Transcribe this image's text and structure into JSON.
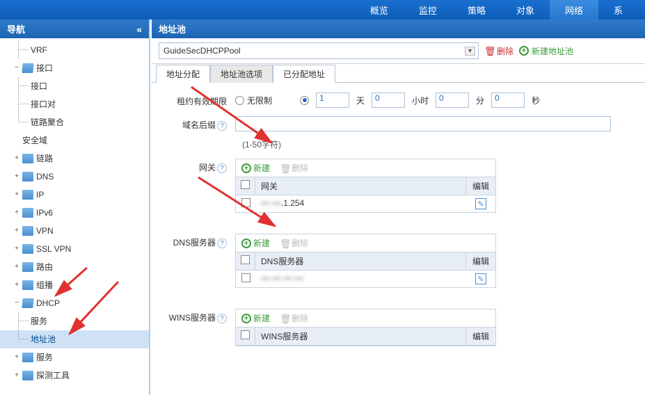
{
  "topnav": {
    "items": [
      "概览",
      "监控",
      "策略",
      "对象",
      "网络",
      "系"
    ],
    "active_index": 4
  },
  "sidebar": {
    "title": "导航",
    "collapse_glyph": "«",
    "tree": [
      {
        "label": "VRF",
        "level": 2,
        "icon": null
      },
      {
        "label": "接口",
        "level": 1,
        "icon": "open",
        "toggle": "−"
      },
      {
        "label": "接口",
        "level": 2,
        "icon": null
      },
      {
        "label": "接口对",
        "level": 2,
        "icon": null
      },
      {
        "label": "链路聚合",
        "level": 2,
        "icon": null,
        "last": true
      },
      {
        "label": "安全域",
        "level": 1,
        "icon": null
      },
      {
        "label": "链路",
        "level": 1,
        "icon": "closed",
        "toggle": "+"
      },
      {
        "label": "DNS",
        "level": 1,
        "icon": "closed",
        "toggle": "+"
      },
      {
        "label": "IP",
        "level": 1,
        "icon": "closed",
        "toggle": "+"
      },
      {
        "label": "IPv6",
        "level": 1,
        "icon": "closed",
        "toggle": "+"
      },
      {
        "label": "VPN",
        "level": 1,
        "icon": "closed",
        "toggle": "+"
      },
      {
        "label": "SSL VPN",
        "level": 1,
        "icon": "closed",
        "toggle": "+"
      },
      {
        "label": "路由",
        "level": 1,
        "icon": "closed",
        "toggle": "+"
      },
      {
        "label": "组播",
        "level": 1,
        "icon": "closed",
        "toggle": "+"
      },
      {
        "label": "DHCP",
        "level": 1,
        "icon": "open",
        "toggle": "−"
      },
      {
        "label": "服务",
        "level": 2,
        "icon": null
      },
      {
        "label": "地址池",
        "level": 2,
        "icon": null,
        "last": true,
        "active": true
      },
      {
        "label": "服务",
        "level": 1,
        "icon": "closed",
        "toggle": "+"
      },
      {
        "label": "探测工具",
        "level": 1,
        "icon": "closed",
        "toggle": "+"
      }
    ]
  },
  "content": {
    "title": "地址池",
    "pool_selected": "GuideSecDHCPPool",
    "delete_label": "删除",
    "new_label": "新建地址池",
    "tabs": [
      "地址分配",
      "地址池选项",
      "已分配地址"
    ],
    "active_tab": 1
  },
  "form": {
    "lease": {
      "label": "租约有效期限",
      "unlimited_label": "无限制",
      "days": "1",
      "days_label": "天",
      "hours": "0",
      "hours_label": "小时",
      "minutes": "0",
      "minutes_label": "分",
      "seconds": "0",
      "seconds_label": "秒"
    },
    "domain_suffix": {
      "label": "域名后缀",
      "value": "",
      "hint": "(1-50字符)"
    },
    "gateway": {
      "label": "网关",
      "add_label": "新建",
      "del_label": "删除",
      "col_name": "网关",
      "col_edit": "编辑",
      "rows": [
        {
          "value": ".1.254",
          "blur": true
        }
      ]
    },
    "dns": {
      "label": "DNS服务器",
      "add_label": "新建",
      "del_label": "删除",
      "col_name": "DNS服务器",
      "col_edit": "编辑",
      "rows": [
        {
          "value": "",
          "blur": true
        }
      ]
    },
    "wins": {
      "label": "WINS服务器",
      "add_label": "新建",
      "del_label": "删除",
      "col_name": "WINS服务器",
      "col_edit": "编辑",
      "rows": []
    }
  }
}
